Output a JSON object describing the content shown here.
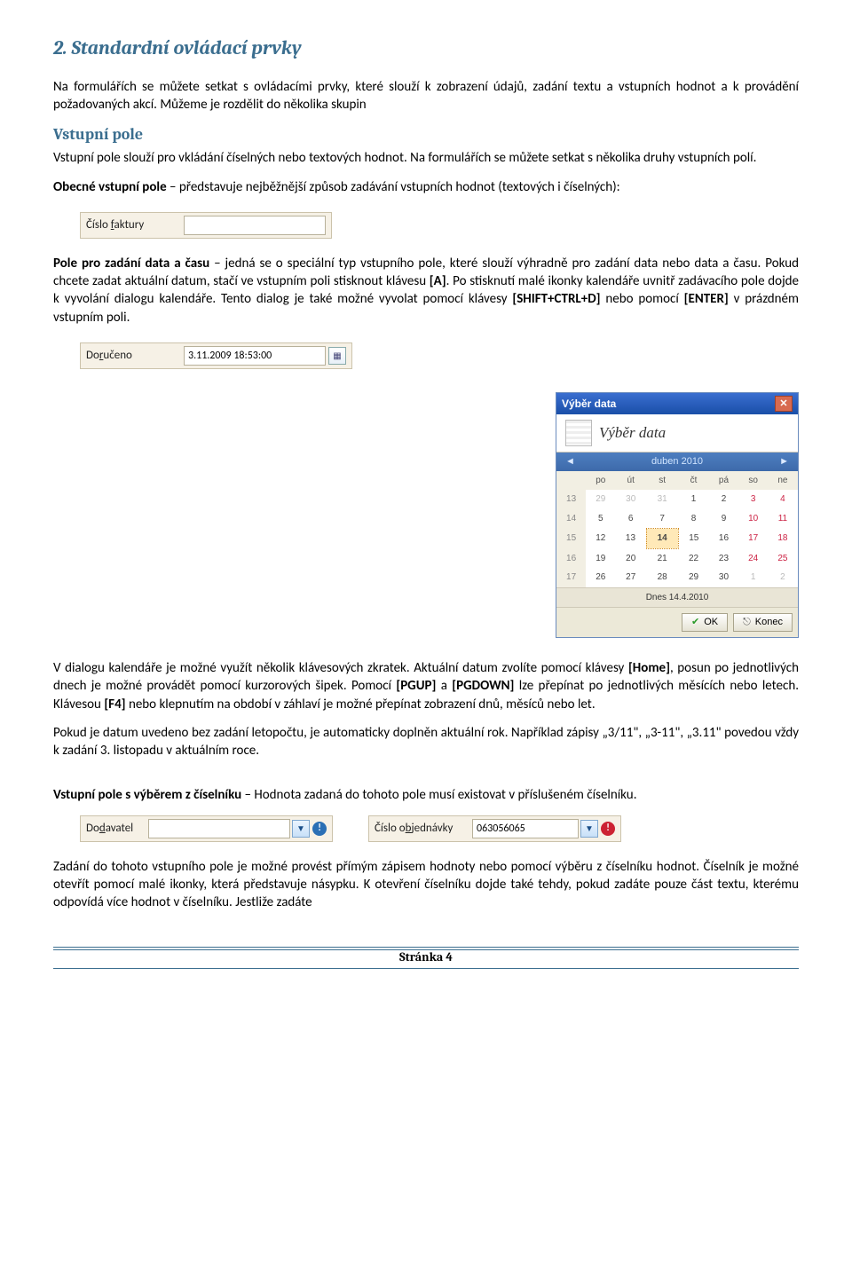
{
  "title": "2. Standardní ovládací prvky",
  "p1": "Na formulářích se můžete setkat s ovládacími prvky, které slouží k zobrazení údajů, zadání textu a vstupních hodnot a k provádění požadovaných akcí. Můžeme je rozdělit do několika skupin",
  "h_vstupni": "Vstupní pole",
  "p2": "Vstupní pole slouží pro vkládání číselných nebo textových hodnot. Na formulářích se můžete setkat s několika druhy vstupních polí.",
  "p3a": "Obecné vstupní pole",
  "p3b": " – představuje nejběžnější způsob zadávání vstupních hodnot (textových i číselných):",
  "field1_label": "Číslo faktury",
  "p4a": "Pole pro zadání data a času",
  "p4b": " – jedná se o speciální typ vstupního pole, které slouží výhradně pro zadání data nebo data a času. Pokud chcete zadat aktuální datum, stačí ve vstupním poli stisknout klávesu ",
  "p4c": "[A]",
  "p4d": ". Po stisknutí malé ikonky kalendáře uvnitř zadávacího pole dojde k vyvolání dialogu kalendáře. Tento dialog je také možné vyvolat pomocí klávesy ",
  "p4e": "[SHIFT+CTRL+D]",
  "p4f": " nebo pomocí ",
  "p4g": "[ENTER]",
  "p4h": " v prázdném vstupním poli.",
  "field2_label": "Doručeno",
  "field2_value": "3.11.2009 18:53:00",
  "cal": {
    "titlebar": "Výběr data",
    "header": "Výběr data",
    "month": "duben 2010",
    "days": [
      "po",
      "út",
      "st",
      "čt",
      "pá",
      "so",
      "ne"
    ],
    "rows": [
      {
        "wk": "13",
        "d": [
          "29",
          "30",
          "31",
          "1",
          "2",
          "3",
          "4"
        ],
        "dim": [
          0,
          1,
          2
        ],
        "we": [
          5,
          6
        ]
      },
      {
        "wk": "14",
        "d": [
          "5",
          "6",
          "7",
          "8",
          "9",
          "10",
          "11"
        ],
        "we": [
          5,
          6
        ]
      },
      {
        "wk": "15",
        "d": [
          "12",
          "13",
          "14",
          "15",
          "16",
          "17",
          "18"
        ],
        "sel": 2,
        "we": [
          5,
          6
        ]
      },
      {
        "wk": "16",
        "d": [
          "19",
          "20",
          "21",
          "22",
          "23",
          "24",
          "25"
        ],
        "we": [
          5,
          6
        ]
      },
      {
        "wk": "17",
        "d": [
          "26",
          "27",
          "28",
          "29",
          "30",
          "1",
          "2"
        ],
        "dim": [
          5,
          6
        ]
      }
    ],
    "today": "Dnes 14.4.2010",
    "ok": "OK",
    "konec": "Konec"
  },
  "p5a": "V dialogu kalendáře je možné využít několik klávesových zkratek. Aktuální datum zvolíte pomocí klávesy ",
  "p5b": "[Home]",
  "p5c": ", posun po jednotlivých dnech je možné provádět pomocí kurzorových šipek. Pomocí ",
  "p5d": "[PGUP]",
  "p5e": " a ",
  "p5f": "[PGDOWN]",
  "p5g": " lze přepínat po jednotlivých měsících nebo letech. Klávesou ",
  "p5h": "[F4]",
  "p5i": " nebo klepnutím na období v záhlaví je možné přepínat zobrazení dnů, měsíců nebo let.",
  "p6": "Pokud je datum uvedeno bez zadání letopočtu, je automaticky doplněn aktuální rok. Například zápisy „3/11\", „3-11\", „3.11\" povedou vždy k zadání 3. listopadu v aktuálním roce.",
  "p7a": "Vstupní pole s výběrem z číselníku",
  "p7b": " – Hodnota zadaná do tohoto pole musí existovat v příslušeném číselníku.",
  "field3_label": "Dodavatel",
  "field4_label": "Číslo objednávky",
  "field4_value": "063056065",
  "p8": "Zadání do tohoto vstupního pole je možné provést přímým zápisem hodnoty nebo pomocí výběru z číselníku hodnot. Číselník je možné otevřít pomocí malé ikonky, která představuje násypku. K otevření číselníku dojde také tehdy, pokud zadáte pouze část textu, kterému odpovídá více hodnot v číselníku. Jestliže zadáte",
  "footer": "Stránka 4"
}
